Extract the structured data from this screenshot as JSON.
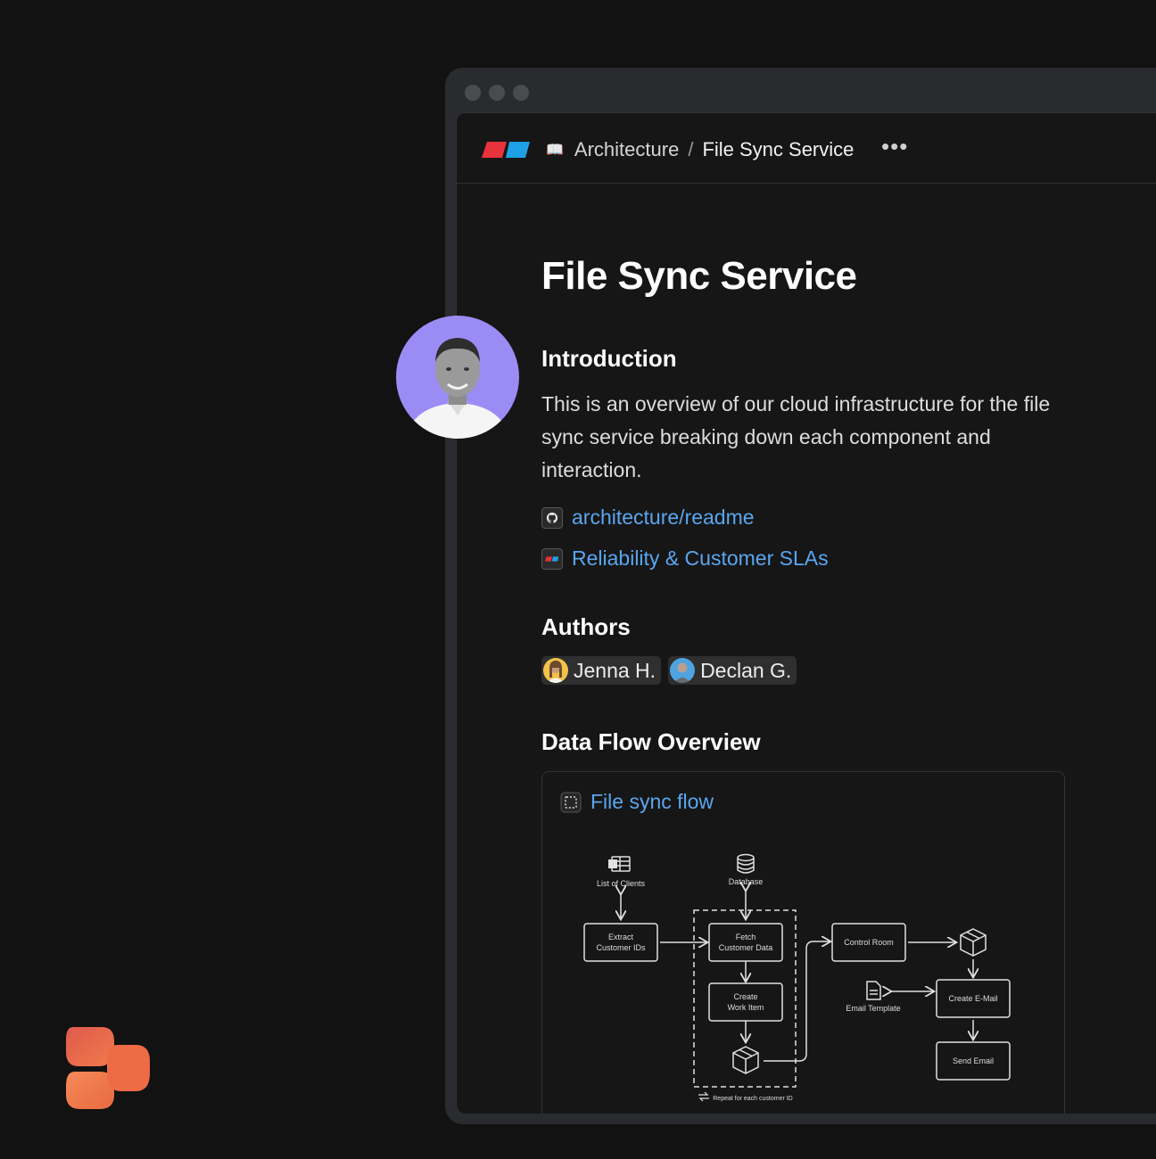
{
  "breadcrumb": {
    "parent": "Architecture",
    "separator": "/",
    "current": "File Sync Service"
  },
  "page": {
    "title": "File Sync Service",
    "intro_heading": "Introduction",
    "intro_text": "This is an overview of our cloud infrastructure for the file sync service breaking down each component and interaction.",
    "links": [
      {
        "label": "architecture/readme",
        "icon": "github-icon"
      },
      {
        "label": "Reliability & Customer SLAs",
        "icon": "app-logo-icon"
      }
    ],
    "authors_heading": "Authors",
    "authors": [
      {
        "name": "Jenna H."
      },
      {
        "name": "Declan G."
      }
    ],
    "flow_heading": "Data Flow Overview",
    "flow_card_title": "File sync flow"
  },
  "diagram": {
    "list_of_clients": "List of Clients",
    "database": "Database",
    "extract_1": "Extract",
    "extract_2": "Customer IDs",
    "fetch_1": "Fetch",
    "fetch_2": "Customer Data",
    "create_1": "Create",
    "create_2": "Work Item",
    "control_room": "Control Room",
    "email_template": "Email Template",
    "create_email": "Create E-Mail",
    "send_email": "Send Email",
    "repeat": "Repeat for each customer ID"
  },
  "colors": {
    "link": "#5aa6f0",
    "avatar_bg": "#9b8cf5",
    "logo_red": "#e8323c",
    "logo_blue": "#1ea0e6"
  }
}
